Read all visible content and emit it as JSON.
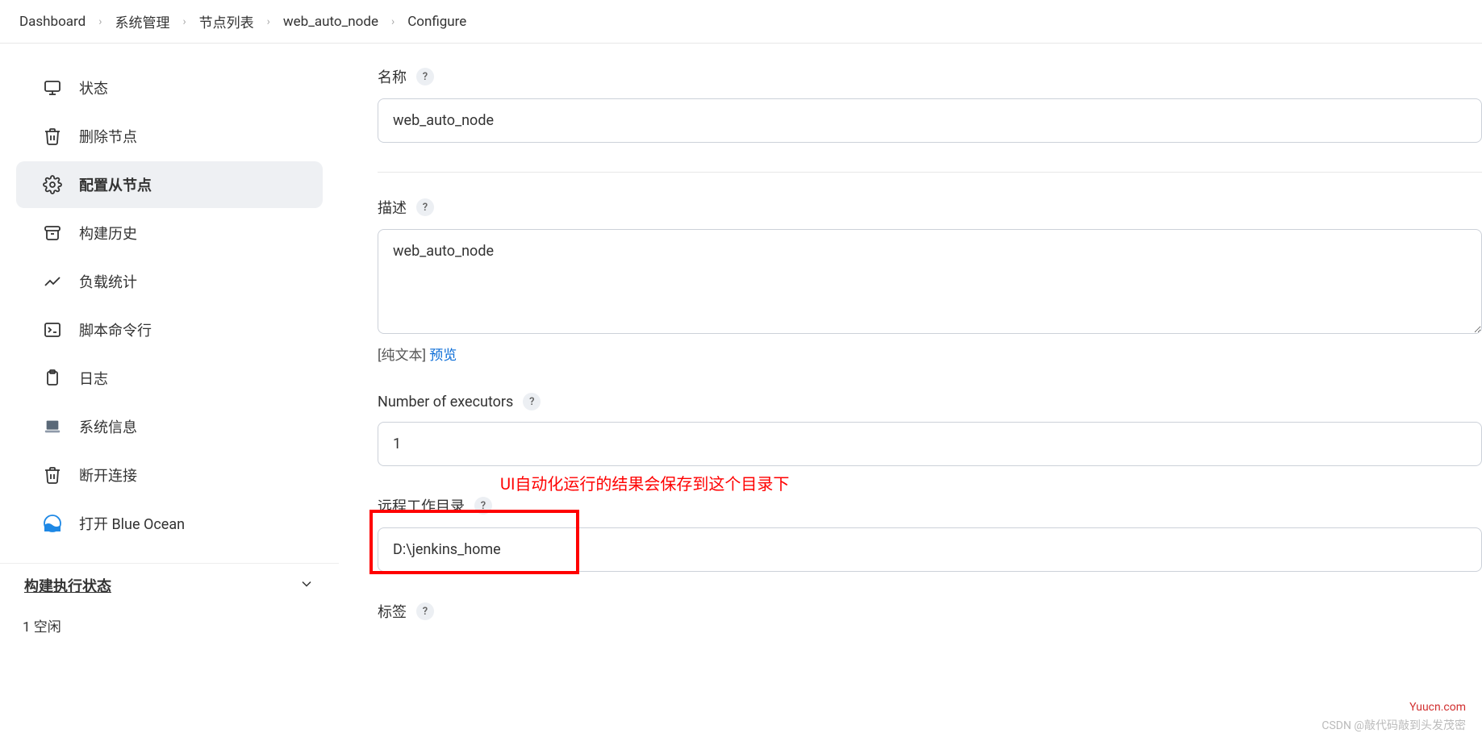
{
  "breadcrumb": [
    {
      "label": "Dashboard"
    },
    {
      "label": "系统管理"
    },
    {
      "label": "节点列表"
    },
    {
      "label": "web_auto_node"
    },
    {
      "label": "Configure"
    }
  ],
  "sidebar": {
    "items": [
      {
        "label": "状态"
      },
      {
        "label": "删除节点"
      },
      {
        "label": "配置从节点"
      },
      {
        "label": "构建历史"
      },
      {
        "label": "负载统计"
      },
      {
        "label": "脚本命令行"
      },
      {
        "label": "日志"
      },
      {
        "label": "系统信息"
      },
      {
        "label": "断开连接"
      },
      {
        "label": "打开 Blue Ocean"
      }
    ],
    "section": {
      "title": "构建执行状态",
      "sub": "1 空闲"
    }
  },
  "form": {
    "name": {
      "label": "名称",
      "value": "web_auto_node"
    },
    "description": {
      "label": "描述",
      "value": "web_auto_node",
      "plain": "[纯文本] ",
      "preview": "预览"
    },
    "executors": {
      "label": "Number of executors",
      "value": "1"
    },
    "remote_dir": {
      "label": "远程工作目录",
      "value": "D:\\jenkins_home"
    },
    "tags": {
      "label": "标签"
    }
  },
  "annotation": "UI自动化运行的结果会保存到这个目录下",
  "watermark": {
    "line1": "Yuucn.com",
    "line2": "CSDN @敲代码敲到头发茂密"
  }
}
